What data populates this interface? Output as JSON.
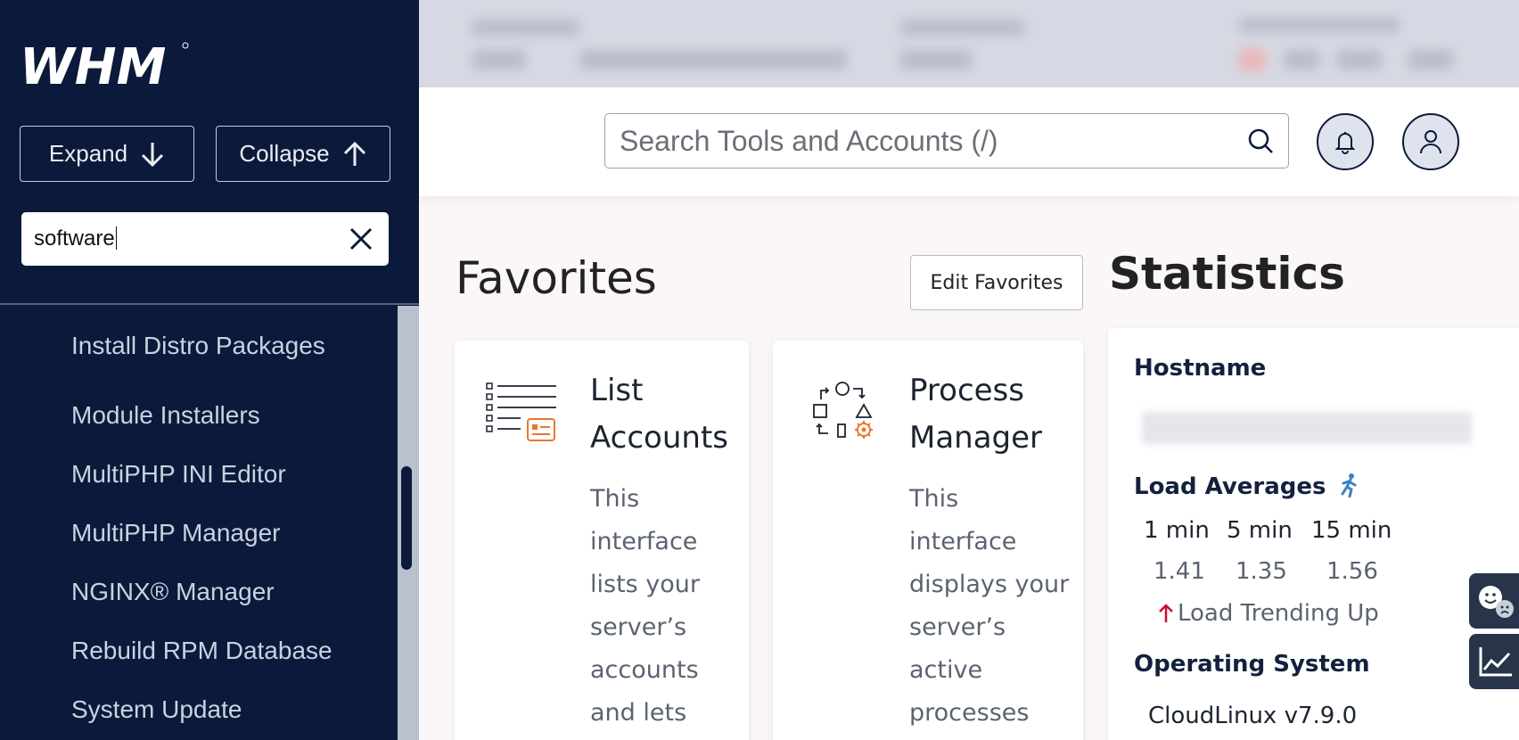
{
  "app": {
    "logo_text": "WHM"
  },
  "sidebar": {
    "expand_label": "Expand",
    "collapse_label": "Collapse",
    "search_value": "software",
    "items": [
      {
        "label": "Install Distro Packages"
      },
      {
        "label": "Module Installers"
      },
      {
        "label": "MultiPHP INI Editor"
      },
      {
        "label": "MultiPHP Manager"
      },
      {
        "label": "NGINX® Manager"
      },
      {
        "label": "Rebuild RPM Database"
      },
      {
        "label": "System Update"
      }
    ]
  },
  "header": {
    "search_placeholder": "Search Tools and Accounts (/)",
    "icons": [
      "search-icon",
      "bell-icon",
      "user-icon"
    ]
  },
  "favorites": {
    "title": "Favorites",
    "edit_label": "Edit Favorites",
    "cards": [
      {
        "title": "List Accounts",
        "desc": "This interface lists your server’s accounts and lets",
        "icon": "list-accounts-icon"
      },
      {
        "title": "Process Manager",
        "desc": "This interface displays your server’s active processes",
        "icon": "process-manager-icon"
      }
    ]
  },
  "statistics": {
    "title": "Statistics",
    "hostname_label": "Hostname",
    "load_label": "Load Averages",
    "load_headers": [
      "1 min",
      "5 min",
      "15 min"
    ],
    "load_values": [
      "1.41",
      "1.35",
      "1.56"
    ],
    "trend_text": "Load Trending Up",
    "os_label": "Operating System",
    "os_value": "CloudLinux v7.9.0"
  },
  "colors": {
    "sidebar_bg": "#0b1a3a",
    "accent_orange": "#e8772e",
    "trend_red": "#c8102e",
    "runner_blue": "#3b82c4"
  }
}
